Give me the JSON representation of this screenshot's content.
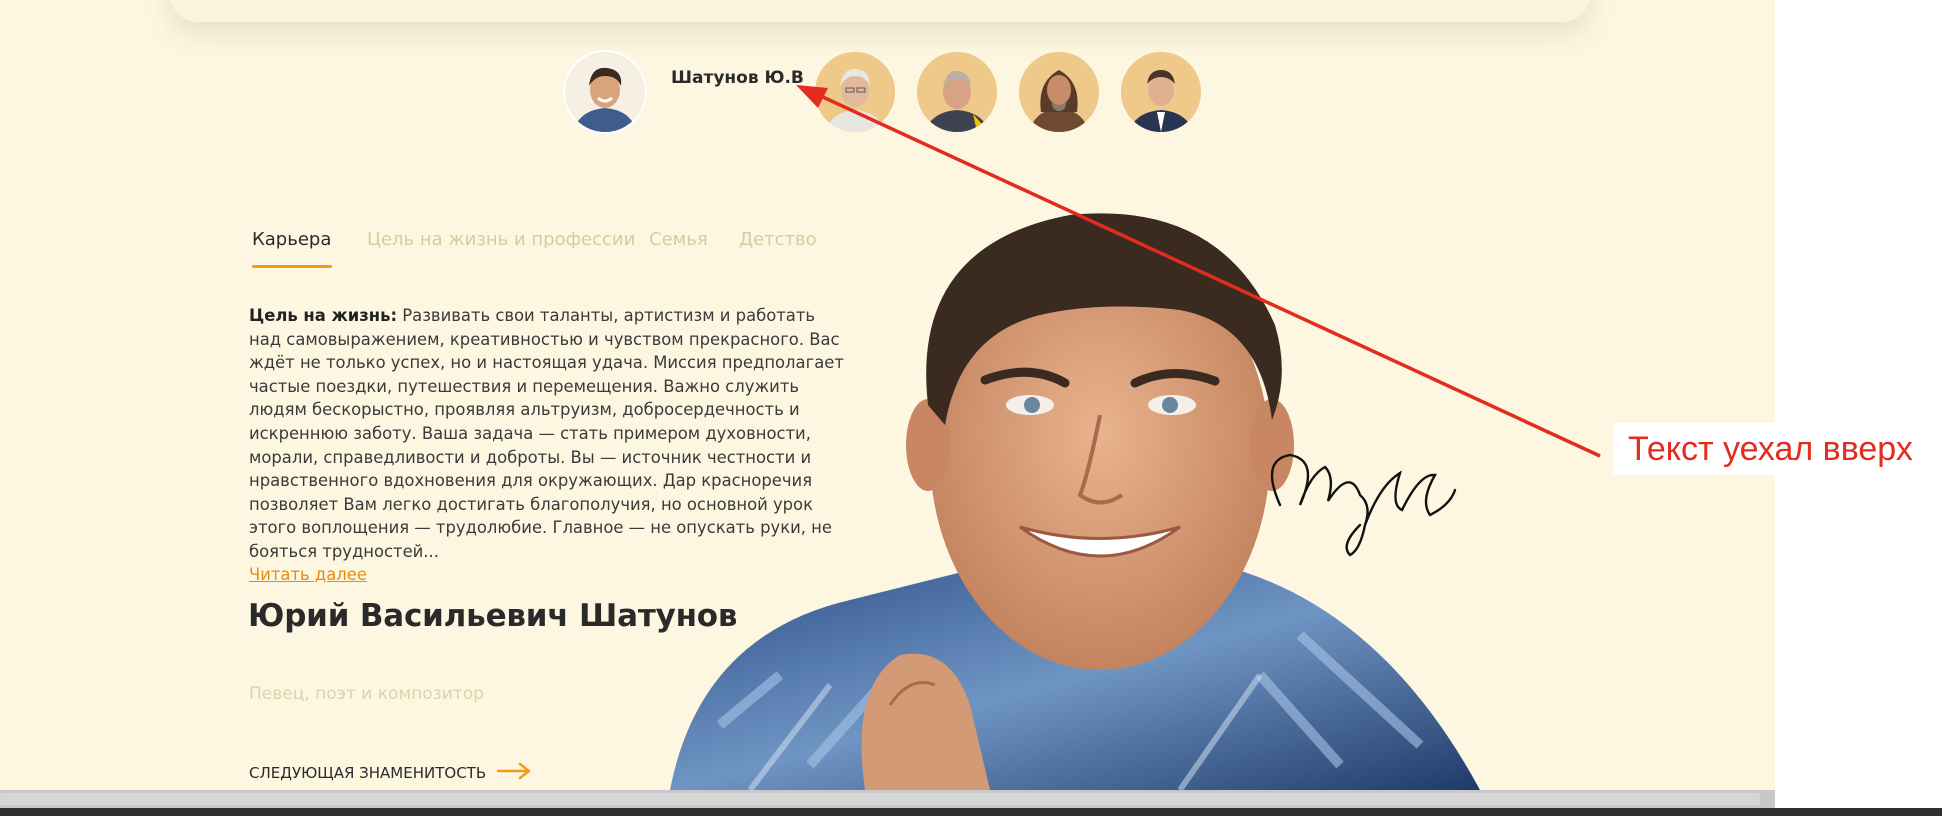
{
  "celebrity_selector": {
    "active_name": "Шатунов Ю.В",
    "avatars": [
      {
        "icon": "avatar-shatunov"
      },
      {
        "icon": "avatar-white-haired-man"
      },
      {
        "icon": "avatar-man-in-suit"
      },
      {
        "icon": "avatar-long-haired-man"
      },
      {
        "icon": "avatar-young-man-suit"
      }
    ]
  },
  "tabs": [
    {
      "label": "Карьера",
      "active": true
    },
    {
      "label": "Цель на жизнь и профессии",
      "active": false
    },
    {
      "label": "Семья",
      "active": false
    },
    {
      "label": "Детство",
      "active": false
    }
  ],
  "bio": {
    "heading": "Цель на жизнь:",
    "text": "Развивать свои таланты, артистизм и работать над самовыражением, креативностью и чувством прекрасного. Вас ждёт не только успех, но и настоящая удача. Миссия предполагает частые поездки, путешествия и перемещения. Важно служить людям бескорыстно, проявляя альтруизм, добросердечность и искреннюю заботу. Ваша задача — стать примером духовности, морали, справедливости и доброты. Вы — источник честности и нравственного вдохновения для окружающих. Дар красноречия позволяет Вам легко достигать благополучия, но основной урок этого воплощения — трудолюбие. Главное — не опускать руки, не бояться трудностей...",
    "read_more": "Читать далее"
  },
  "person": {
    "full_name": "Юрий Васильевич Шатунов",
    "profession": "Певец, поэт и композитор"
  },
  "next_link": {
    "label": "СЛЕДУЮЩАЯ ЗНАМЕНИТОСТЬ",
    "icon": "arrow-right-icon"
  },
  "annotation": {
    "text": "Текст уехал вверх",
    "color": "#e12c1e"
  },
  "colors": {
    "background": "#fdf7e2",
    "accent": "#f59a12",
    "muted_text": "#d8cc9e"
  }
}
